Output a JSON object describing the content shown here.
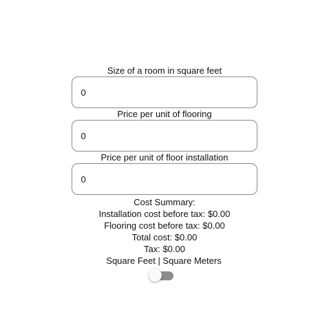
{
  "form": {
    "room_size": {
      "label": "Size of a room in square feet",
      "value": "0"
    },
    "flooring_price": {
      "label": "Price per unit of flooring",
      "value": "0"
    },
    "installation_price": {
      "label": "Price per unit of floor installation",
      "value": "0"
    }
  },
  "summary": {
    "heading": "Cost Summary:",
    "installation_cost": "Installation cost before tax: $0.00",
    "flooring_cost": "Flooring cost before tax: $0.00",
    "total_cost": "Total cost: $0.00",
    "tax": "Tax: $0.00"
  },
  "units": {
    "label": "Square Feet | Square Meters",
    "toggle_on": false
  }
}
